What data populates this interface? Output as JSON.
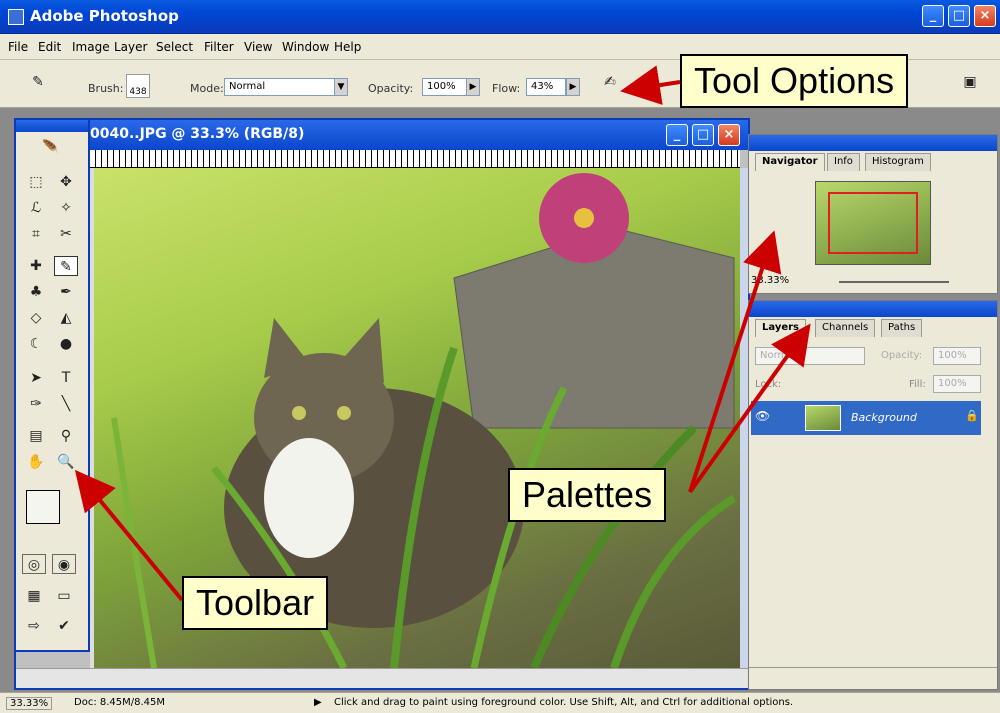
{
  "window": {
    "title": "Adobe Photoshop"
  },
  "menu": [
    "File",
    "Edit",
    "Image",
    "Layer",
    "Select",
    "Filter",
    "View",
    "Window",
    "Help"
  ],
  "options": {
    "brush_label": "Brush:",
    "brush_size": "438",
    "mode_label": "Mode:",
    "mode_value": "Normal",
    "opacity_label": "Opacity:",
    "opacity_value": "100%",
    "flow_label": "Flow:",
    "flow_value": "43%"
  },
  "document": {
    "title": "0040..JPG @ 33.3% (RGB/8)"
  },
  "navigator": {
    "tabs": [
      "Navigator",
      "Info",
      "Histogram"
    ],
    "zoom": "33.33%"
  },
  "layers": {
    "tabs": [
      "Layers",
      "Channels",
      "Paths"
    ],
    "blend_mode": "Normal",
    "opacity_label": "Opacity:",
    "opacity_value": "100%",
    "lock_label": "Lock:",
    "fill_label": "Fill:",
    "fill_value": "100%",
    "layer_name": "Background"
  },
  "status": {
    "zoom": "33.33%",
    "doc": "Doc: 8.45M/8.45M",
    "hint": "Click and drag to paint using foreground color.  Use Shift, Alt, and Ctrl for additional options."
  },
  "callouts": {
    "tool_options": "Tool Options",
    "palettes": "Palettes",
    "toolbar": "Toolbar"
  },
  "colors": {
    "title_blue": "#0a46cc",
    "callout_bg": "#ffffcc",
    "arrow": "#cc0000"
  }
}
